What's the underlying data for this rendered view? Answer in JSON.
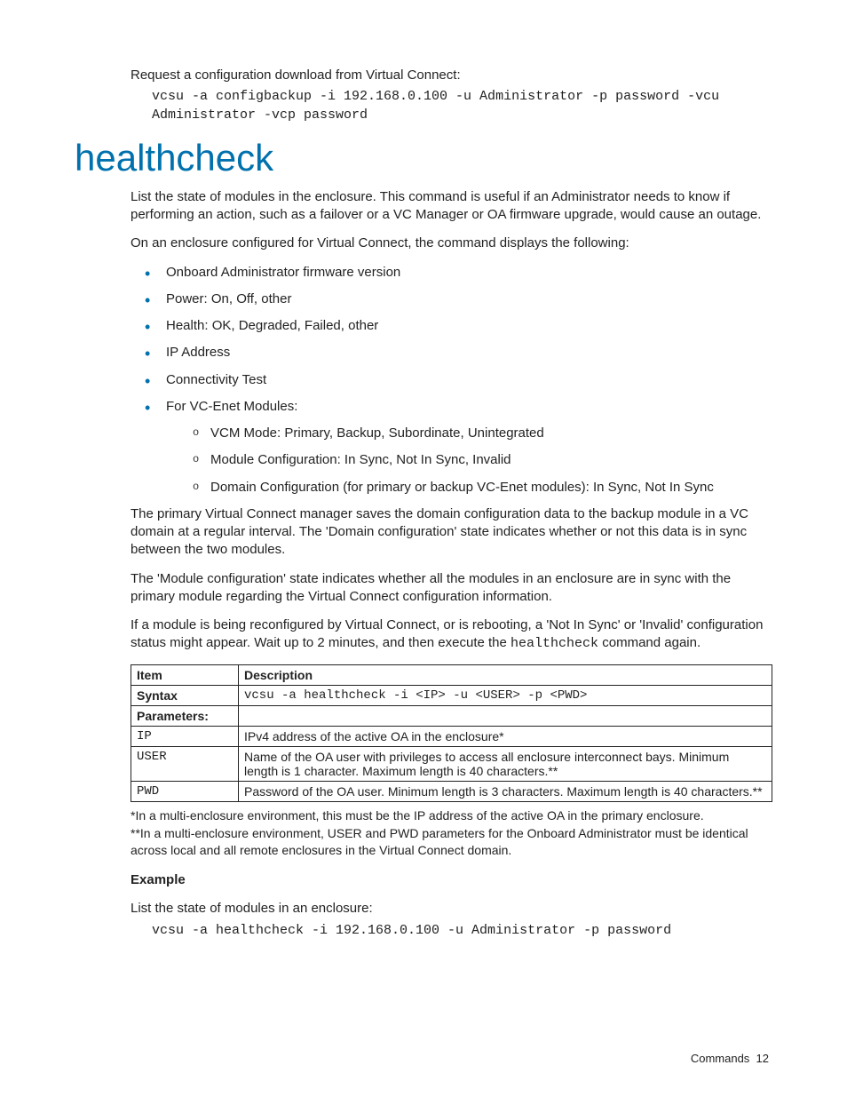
{
  "pre_section": {
    "intro": "Request a configuration download from Virtual Connect:",
    "code": "vcsu -a configbackup -i 192.168.0.100 -u Administrator -p password -vcu Administrator -vcp password"
  },
  "heading": "healthcheck",
  "paragraphs": {
    "p1": "List the state of modules in the enclosure. This command is useful if an Administrator needs to know if performing an action, such as a failover or a VC Manager or OA firmware upgrade, would cause an outage.",
    "p2": "On an enclosure configured for Virtual Connect, the command displays the following:",
    "p3": "The primary Virtual Connect manager saves the domain configuration data to the backup module in a VC domain at a regular interval. The 'Domain configuration' state indicates whether or not this data is in sync between the two modules.",
    "p4": "The 'Module configuration' state indicates whether all the modules in an enclosure are in sync with the primary module regarding the Virtual Connect configuration information.",
    "p5_pre": "If a module is being reconfigured by Virtual Connect, or is rebooting, a 'Not In Sync' or 'Invalid' configuration status might appear. Wait up to 2 minutes, and then execute the ",
    "p5_code": "healthcheck",
    "p5_post": " command again."
  },
  "bullets": {
    "b1": "Onboard Administrator firmware version",
    "b2": "Power: On, Off, other",
    "b3": "Health: OK, Degraded, Failed, other",
    "b4": "IP Address",
    "b5": "Connectivity Test",
    "b6": "For VC-Enet Modules:",
    "s1": "VCM Mode: Primary, Backup, Subordinate, Unintegrated",
    "s2": "Module Configuration: In Sync, Not In Sync, Invalid",
    "s3": "Domain Configuration (for primary or backup VC-Enet modules): In Sync, Not In Sync"
  },
  "table": {
    "h_item": "Item",
    "h_desc": "Description",
    "syntax_label": "Syntax",
    "syntax_value": "vcsu -a healthcheck -i <IP> -u <USER> -p <PWD>",
    "params_label": "Parameters:",
    "rows": {
      "ip_name": "IP",
      "ip_desc": "IPv4 address of the active OA in the enclosure*",
      "user_name": "USER",
      "user_desc": "Name of the OA user with privileges to access all enclosure interconnect bays. Minimum length is 1 character. Maximum length is 40 characters.**",
      "pwd_name": "PWD",
      "pwd_desc": "Password of the OA user. Minimum length is 3 characters. Maximum length is 40 characters.**"
    }
  },
  "notes": {
    "n1": "*In a multi-enclosure environment, this must be the IP address of the active OA in the primary enclosure.",
    "n2": "**In a multi-enclosure environment, USER and PWD parameters for the Onboard Administrator must be identical across local and all remote enclosures in the Virtual Connect domain."
  },
  "example": {
    "label": "Example",
    "intro": "List the state of modules in an enclosure:",
    "code": "vcsu -a healthcheck -i 192.168.0.100 -u Administrator -p password"
  },
  "footer": {
    "section": "Commands",
    "page": "12"
  }
}
